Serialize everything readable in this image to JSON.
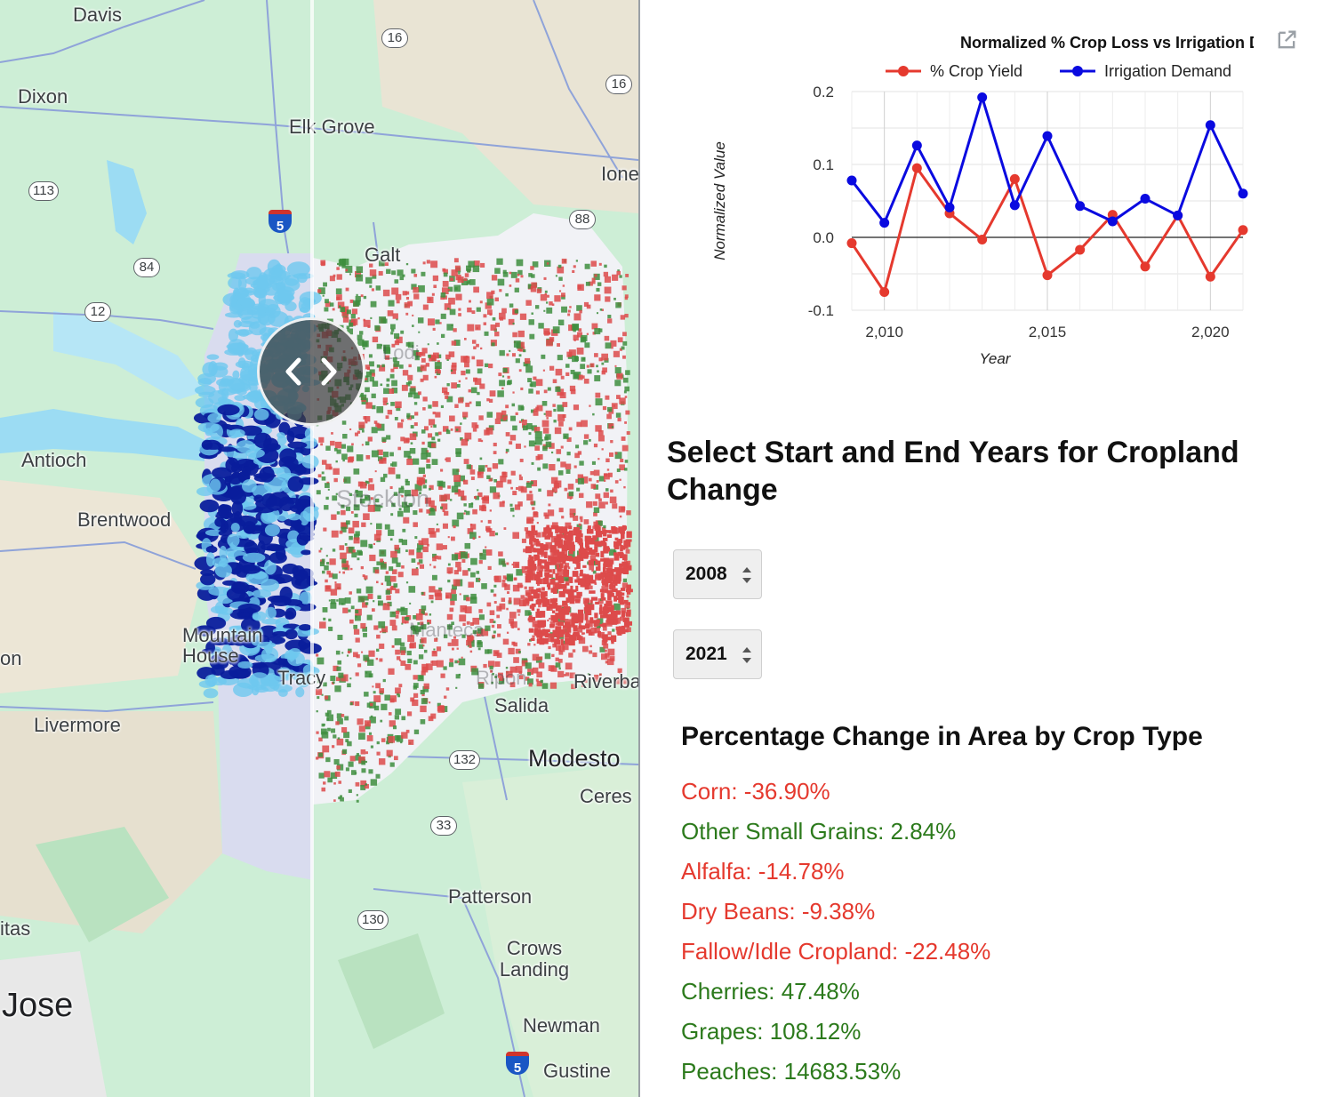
{
  "map": {
    "places": {
      "davis": "Davis",
      "dixon": "Dixon",
      "elk_grove": "Elk Grove",
      "ione": "Ione",
      "galt": "Galt",
      "lodi": "Lodi",
      "antioch": "Antioch",
      "brentwood": "Brentwood",
      "stockton": "Stockton",
      "manteca": "Manteca",
      "mountain_house": "Mountain House",
      "tracy": "Tracy",
      "ripon": "Ripon",
      "riverbank": "Riverbank",
      "salida": "Salida",
      "livermore": "Livermore",
      "modesto": "Modesto",
      "ceres": "Ceres",
      "patterson": "Patterson",
      "crows_landing": "Crows Landing",
      "newman": "Newman",
      "gustine": "Gustine",
      "san_jose": "Jose",
      "milpitas": "itas",
      "pleasanton": "on"
    },
    "routes": [
      "16",
      "16",
      "113",
      "84",
      "12",
      "88",
      "132",
      "33",
      "130"
    ],
    "interstates": [
      "5",
      "5"
    ],
    "colors": {
      "base_green": "#cdeed6",
      "water": "#9cdcf3",
      "gain": "#3e8e3e",
      "loss": "#dd4b4b",
      "precip_dark": "#0a1e9c",
      "precip_light": "#6ec8ef"
    }
  },
  "chart": {
    "open_icon": "open-in-new-icon",
    "chart_data": {
      "type": "line",
      "title": "Normalized % Crop Loss vs Irrigation Demand",
      "xlabel": "Year",
      "ylabel": "Normalized Value",
      "xlim": [
        2009,
        2021
      ],
      "ylim": [
        -0.1,
        0.2
      ],
      "x_ticks": [
        "2,010",
        "2,015",
        "2,020"
      ],
      "y_ticks": [
        "0.2",
        "0.1",
        "0.0",
        "-0.1"
      ],
      "legend": "top",
      "grid": true,
      "x": [
        2009,
        2010,
        2011,
        2012,
        2013,
        2014,
        2015,
        2016,
        2017,
        2018,
        2019,
        2020,
        2021
      ],
      "series": [
        {
          "name": "% Crop Yield",
          "color": "#e5392e",
          "values": [
            -0.008,
            -0.075,
            0.095,
            0.033,
            -0.003,
            0.08,
            -0.052,
            -0.017,
            0.031,
            -0.04,
            0.03,
            -0.054,
            0.01
          ]
        },
        {
          "name": "Irrigation Demand",
          "color": "#0a0ae0",
          "values": [
            0.078,
            0.02,
            0.126,
            0.041,
            0.192,
            0.044,
            0.139,
            0.043,
            0.022,
            0.053,
            0.03,
            0.154,
            0.06
          ]
        }
      ]
    }
  },
  "selector": {
    "heading": "Select Start and End Years for Cropland Change",
    "start_year": "2008",
    "end_year": "2021"
  },
  "change": {
    "heading": "Percentage Change in Area by Crop Type",
    "positive_color": "#2c7a1c",
    "negative_color": "#e5392e",
    "items": [
      {
        "text": "Corn: -36.90%",
        "trend": "negative"
      },
      {
        "text": "Other Small Grains: 2.84%",
        "trend": "positive"
      },
      {
        "text": "Alfalfa: -14.78%",
        "trend": "negative"
      },
      {
        "text": "Dry Beans: -9.38%",
        "trend": "negative"
      },
      {
        "text": "Fallow/Idle Cropland: -22.48%",
        "trend": "negative"
      },
      {
        "text": "Cherries: 47.48%",
        "trend": "positive"
      },
      {
        "text": "Grapes: 108.12%",
        "trend": "positive"
      },
      {
        "text": "Peaches: 14683.53%",
        "trend": "positive"
      }
    ]
  }
}
